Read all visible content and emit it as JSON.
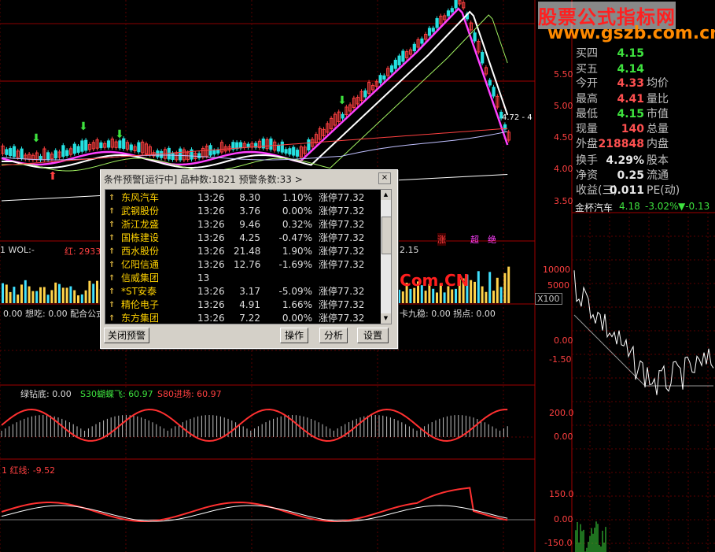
{
  "watermark": {
    "title": "股票公式指标网",
    "url": "www.gszb.com.cn",
    "overlay": "股海网提供 Www.Guhai.Com.CN"
  },
  "price_axis": [
    "5.50",
    "5.00",
    "4.50",
    "4.00",
    "3.50"
  ],
  "price_tag": "4.72 - 4",
  "vol_axis": [
    "10000",
    "5000"
  ],
  "x100": "X100",
  "ind2_axis": [
    "0.00",
    "-1.50"
  ],
  "ind3_axis": [
    "200.0",
    "0.00"
  ],
  "ind4_axis": [
    "150.0",
    "0.00",
    "-150.0"
  ],
  "labels": {
    "vol": "1 WOL:-",
    "red": "红: 2933",
    "ind2_left": "0.00  想吃: 0.00  配合公式",
    "ind2_right": "卡九稳: 0.00   拐点: 0.00",
    "ind3": "绿钻底: 0.00",
    "ind3_b": "S30蝴蝶飞: 60.97",
    "ind3_c": "S80进场: 60.97",
    "ind4": "1  红线: -9.52",
    "vol_right": "2.15",
    "zhang": "涨",
    "chao": "超",
    "jueji": "绝"
  },
  "quote": {
    "rows": [
      {
        "l1": "买四",
        "v1": "4.15",
        "l2": "",
        "v2": ""
      },
      {
        "l1": "买五",
        "v1": "4.14",
        "l2": "",
        "v2": ""
      },
      {
        "l1": "今开",
        "v1": "4.33",
        "l2": "均价",
        "v2": ""
      },
      {
        "l1": "最高",
        "v1": "4.41",
        "l2": "量比",
        "v2": ""
      },
      {
        "l1": "最低",
        "v1": "4.15",
        "l2": "市值",
        "v2": ""
      },
      {
        "l1": "现量",
        "v1": "140",
        "l2": "总量",
        "v2": ""
      },
      {
        "l1": "外盘",
        "v1": "218848",
        "l2": "内盘",
        "v2": ""
      },
      {
        "l1": "换手",
        "v1": "4.29%",
        "l2": "股本",
        "v2": ""
      },
      {
        "l1": "净资",
        "v1": "0.25",
        "l2": "流通",
        "v2": ""
      },
      {
        "l1": "收益(三)",
        "v1": "0.011",
        "l2": "PE(动)",
        "v2": ""
      }
    ],
    "mini_title": "金杯汽车",
    "mini_price": "4.18",
    "mini_pct": "-3.02%",
    "mini_chg": "▼-0.13",
    "mini_axis_1": "0.00",
    "mini_axis_2": "-1.50"
  },
  "dialog": {
    "title": "条件预警[运行中] 品种数:1821 预警条数:33  >",
    "close": "×",
    "rows": [
      {
        "name": "东风汽车",
        "time": "13:26",
        "price": "8.30",
        "pct": "1.10%",
        "status": "涨停77.32"
      },
      {
        "name": "武钢股份",
        "time": "13:26",
        "price": "3.76",
        "pct": "0.00%",
        "status": "涨停77.32"
      },
      {
        "name": "浙江龙盛",
        "time": "13:26",
        "price": "9.46",
        "pct": "0.32%",
        "status": "涨停77.32"
      },
      {
        "name": "国栋建设",
        "time": "13:26",
        "price": "4.25",
        "pct": "-0.47%",
        "status": "涨停77.32"
      },
      {
        "name": "西水股份",
        "time": "13:26",
        "price": "21.48",
        "pct": "1.90%",
        "status": "涨停77.32"
      },
      {
        "name": "亿阳信通",
        "time": "13:26",
        "price": "12.76",
        "pct": "-1.69%",
        "status": "涨停77.32"
      },
      {
        "name": "信威集团",
        "time": "13",
        "price": "",
        "pct": "",
        "status": ""
      },
      {
        "name": "*ST安泰",
        "time": "13:26",
        "price": "3.17",
        "pct": "-5.09%",
        "status": "涨停77.32"
      },
      {
        "name": "精伦电子",
        "time": "13:26",
        "price": "4.91",
        "pct": "1.66%",
        "status": "涨停77.32"
      },
      {
        "name": "东方集团",
        "time": "13:26",
        "price": "7.22",
        "pct": "0.00%",
        "status": "涨停77.32"
      }
    ],
    "buttons": {
      "close_alert": "关闭预警",
      "operate": "操作",
      "analyze": "分析",
      "settings": "设置"
    }
  },
  "colors": {
    "up": "#ff4040",
    "down": "#25e0e0",
    "grid": "#7a0000",
    "ma_white": "#ffffff",
    "ma_pink": "#ff40ff",
    "ma_green": "#a0f060"
  }
}
